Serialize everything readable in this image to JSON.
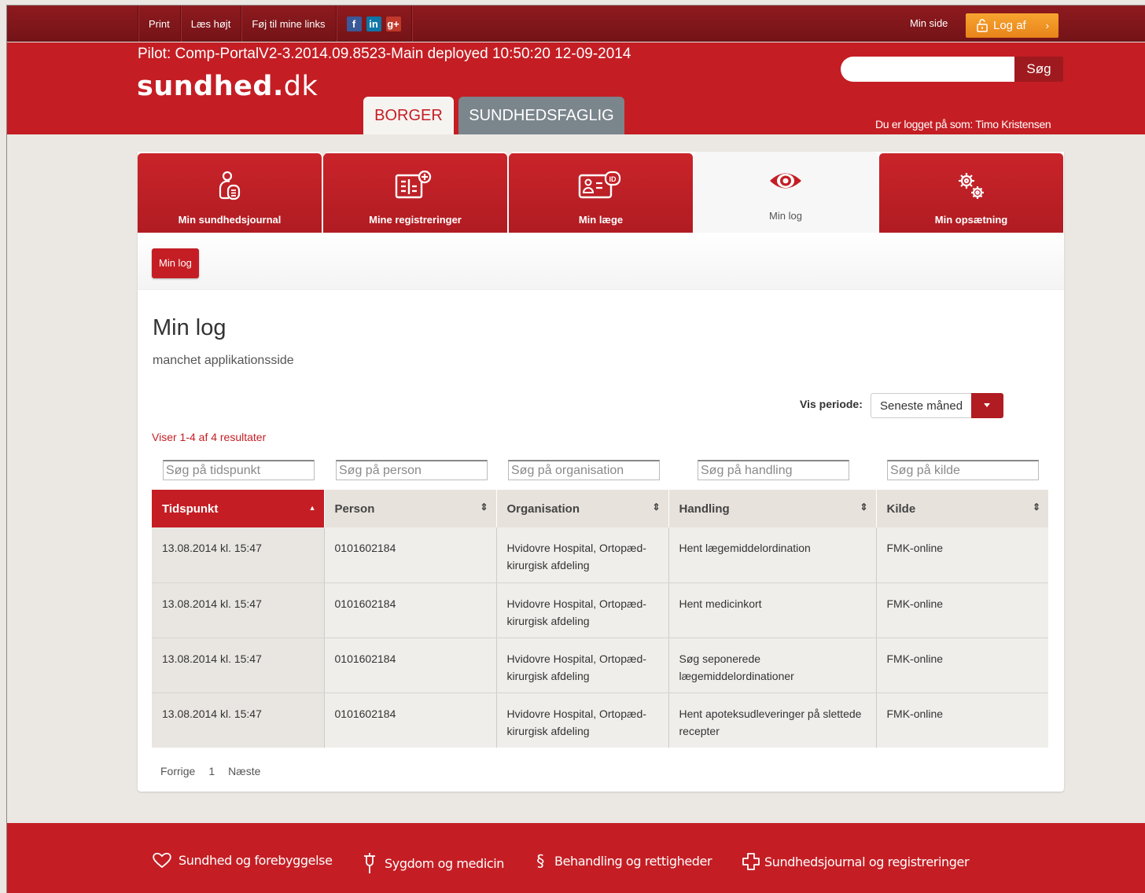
{
  "topbar": {
    "print": "Print",
    "read_aloud": "Læs højt",
    "add_links": "Føj til mine links",
    "social": [
      "f",
      "in",
      "g+"
    ],
    "my_page": "Min side",
    "logout": "Log af",
    "logout_chevron": "›"
  },
  "header": {
    "deploy_info": "Pilot: Comp-PortalV2-3.2014.09.8523-Main deployed 10:50:20 12-09-2014",
    "logo_main": "sundhed",
    "logo_dot": ".",
    "logo_tld": "dk",
    "search_value": "",
    "search_button": "Søg",
    "tabs": [
      "BORGER",
      "SUNDHEDSFAGLIG"
    ],
    "logged_in": "Du er logget på som: Timo Kristensen"
  },
  "nav": {
    "tabs": [
      {
        "label": "Min sundhedsjournal",
        "icon": "person-document-icon"
      },
      {
        "label": "Mine registreringer",
        "icon": "registration-card-icon"
      },
      {
        "label": "Min læge",
        "icon": "doctor-id-card-icon"
      },
      {
        "label": "Min log",
        "icon": "eye-icon"
      },
      {
        "label": "Min opsætning",
        "icon": "gears-icon"
      }
    ],
    "active_index": 3
  },
  "breadcrumb": "Min log",
  "page": {
    "title": "Min log",
    "subtitle": "manchet applikationsside",
    "period_label": "Vis periode:",
    "period_value": "Seneste måned",
    "result_count": "Viser 1-4 af 4 resultater"
  },
  "filters": [
    "Søg på tidspunkt",
    "Søg på person",
    "Søg på organisation",
    "Søg på handling",
    "Søg på kilde"
  ],
  "table": {
    "headers": [
      "Tidspunkt",
      "Person",
      "Organisation",
      "Handling",
      "Kilde"
    ],
    "rows": [
      [
        "13.08.2014 kl. 15:47",
        "0101602184",
        "Hvidovre Hospital, Ortopæd-kirurgisk afdeling",
        "Hent lægemiddelordination",
        "FMK-online"
      ],
      [
        "13.08.2014 kl. 15:47",
        "0101602184",
        "Hvidovre Hospital, Ortopæd-kirurgisk afdeling",
        "Hent medicinkort",
        "FMK-online"
      ],
      [
        "13.08.2014 kl. 15:47",
        "0101602184",
        "Hvidovre Hospital, Ortopæd-kirurgisk afdeling",
        "Søg seponerede lægemiddelordinationer",
        "FMK-online"
      ],
      [
        "13.08.2014 kl. 15:47",
        "0101602184",
        "Hvidovre Hospital, Ortopæd-kirurgisk afdeling",
        "Hent apoteksudleveringer på slettede recepter",
        "FMK-online"
      ]
    ]
  },
  "pager": {
    "prev": "Forrige",
    "page": "1",
    "next": "Næste"
  },
  "footer": [
    {
      "label": "Sundhed og forebyggelse",
      "icon": "heart-icon"
    },
    {
      "label": "Sygdom og medicin",
      "icon": "thermometer-icon"
    },
    {
      "label": "Behandling og rettigheder",
      "icon": "paragraph-icon"
    },
    {
      "label": "Sundhedsjournal og registreringer",
      "icon": "cross-icon"
    }
  ],
  "colors": {
    "brand_red": "#c41e24",
    "dark_red": "#741418",
    "orange": "#f19225",
    "grey_tab": "#7b858c"
  }
}
